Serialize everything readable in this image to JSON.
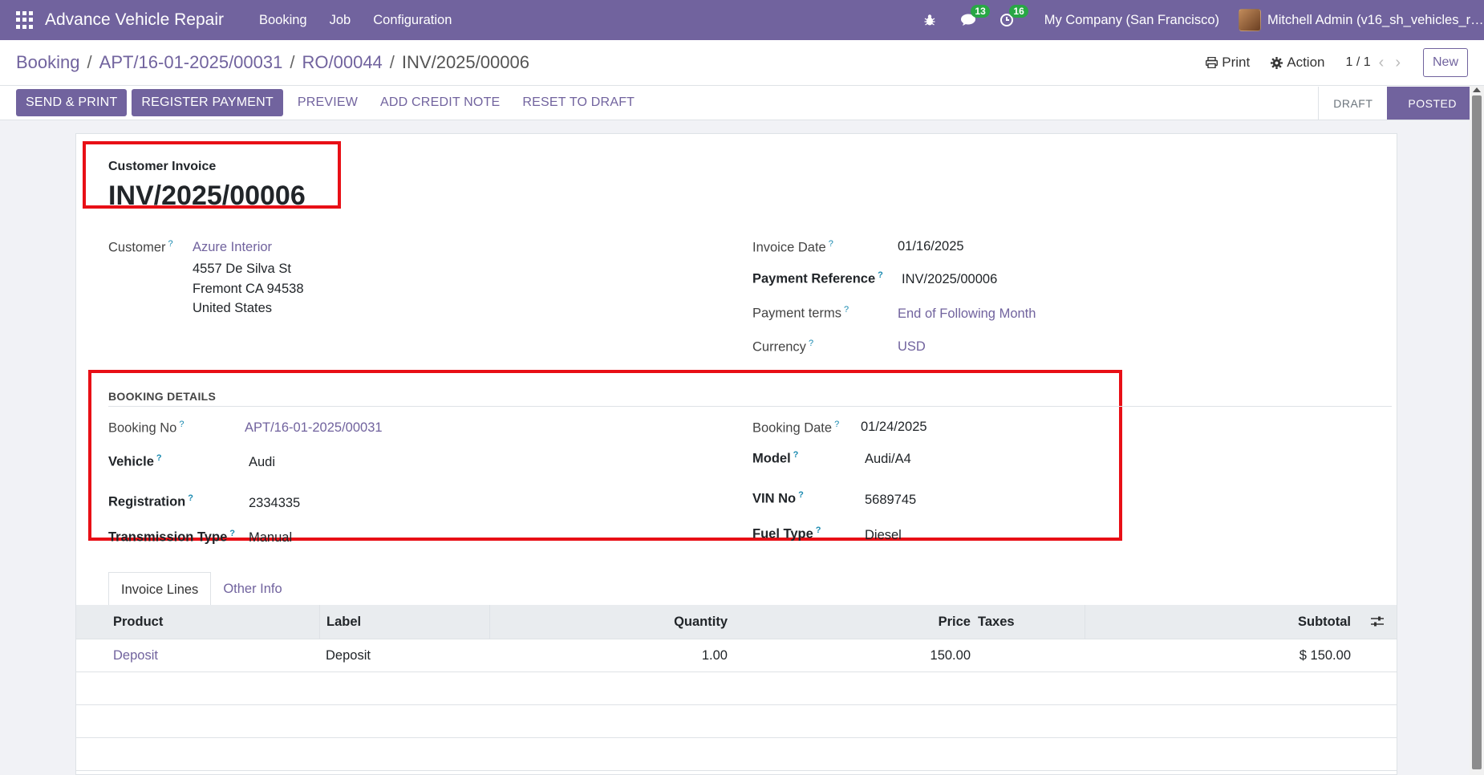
{
  "navbar": {
    "brand": "Advance Vehicle Repair",
    "menu": [
      "Booking",
      "Job",
      "Configuration"
    ],
    "chat_count": "13",
    "activity_count": "16",
    "company": "My Company (San Francisco)",
    "user": "Mitchell Admin (v16_sh_vehicles_repair_management)"
  },
  "breadcrumb": {
    "items": [
      "Booking",
      "APT/16-01-2025/00031",
      "RO/00044"
    ],
    "current": "INV/2025/00006"
  },
  "control": {
    "print": "Print",
    "action": "Action",
    "pager": "1 / 1",
    "new": "New"
  },
  "statusbar": {
    "send_print": "SEND & PRINT",
    "register_payment": "REGISTER PAYMENT",
    "preview": "PREVIEW",
    "add_credit_note": "ADD CREDIT NOTE",
    "reset_to_draft": "RESET TO DRAFT",
    "stage_draft": "DRAFT",
    "stage_posted": "POSTED"
  },
  "invoice": {
    "type": "Customer Invoice",
    "name": "INV/2025/00006",
    "customer_label": "Customer",
    "customer_name": "Azure Interior",
    "address1": "4557 De Silva St",
    "address2": "Fremont CA 94538",
    "address3": "United States",
    "invoice_date_label": "Invoice Date",
    "invoice_date": "01/16/2025",
    "payment_ref_label": "Payment Reference",
    "payment_ref": "INV/2025/00006",
    "payment_terms_label": "Payment terms",
    "payment_terms": "End of Following Month",
    "currency_label": "Currency",
    "currency": "USD"
  },
  "booking": {
    "section_title": "BOOKING DETAILS",
    "booking_no_label": "Booking No",
    "booking_no": "APT/16-01-2025/00031",
    "vehicle_label": "Vehicle",
    "vehicle": "Audi",
    "registration_label": "Registration",
    "registration": "2334335",
    "transmission_label": "Transmission Type",
    "transmission": "Manual",
    "booking_date_label": "Booking Date",
    "booking_date": "01/24/2025",
    "model_label": "Model",
    "model": "Audi/A4",
    "vin_label": "VIN No",
    "vin": "5689745",
    "fuel_label": "Fuel Type",
    "fuel": "Diesel"
  },
  "tabs": [
    "Invoice Lines",
    "Other Info"
  ],
  "lines": {
    "headers": [
      "Product",
      "Label",
      "Quantity",
      "Price",
      "Taxes",
      "Subtotal"
    ],
    "rows": [
      {
        "product": "Deposit",
        "label": "Deposit",
        "quantity": "1.00",
        "price": "150.00",
        "taxes": "",
        "subtotal": "$ 150.00"
      }
    ]
  },
  "help_mark": "?"
}
